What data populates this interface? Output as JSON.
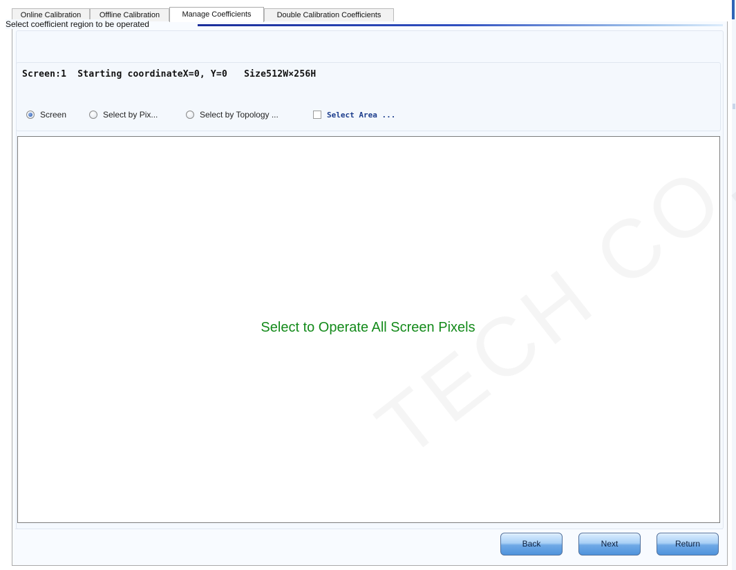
{
  "tabs": [
    {
      "label": "Online Calibration",
      "active": false
    },
    {
      "label": "Offline Calibration",
      "active": false
    },
    {
      "label": "Manage Coefficients",
      "active": true
    },
    {
      "label": "Double Calibration Coefficients",
      "active": false
    }
  ],
  "group": {
    "title": "Select coefficient region to be operated"
  },
  "screen_info": "Screen:1  Starting coordinateX=0, Y=0   Size512W×256H",
  "options": {
    "screen": "Screen",
    "by_pixel": "Select by Pix...",
    "by_topology": "Select by Topology ...",
    "select_area": "Select Area ...",
    "selected": "screen"
  },
  "canvas": {
    "message": "Select to Operate All Screen Pixels",
    "message_color": "#138a1a"
  },
  "buttons": {
    "back": "Back",
    "next": "Next",
    "return": "Return"
  },
  "watermark": "TECH CO., LTD",
  "colors": {
    "accent": "#2f65b7",
    "button_blue": "#4f93dc"
  }
}
